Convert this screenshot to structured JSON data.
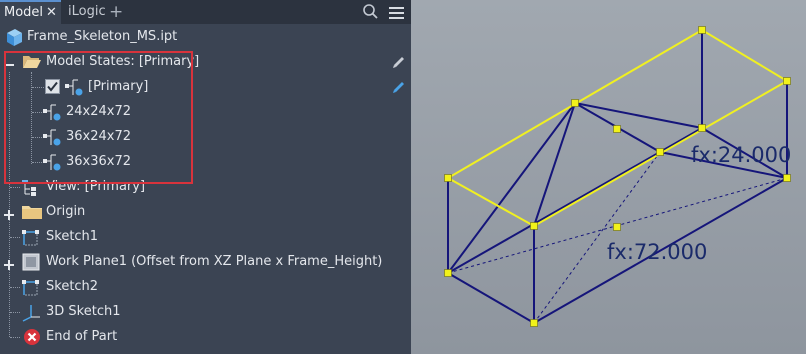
{
  "tabs": {
    "model_label": "Model",
    "model_close_glyph": "✕",
    "ilogic_label": "iLogic",
    "add_glyph": "+"
  },
  "tree": {
    "file_name": "Frame_Skeleton_MS.ipt",
    "model_states_label": "Model States: [Primary]",
    "states": [
      "[Primary]",
      "24x24x72",
      "36x24x72",
      "36x36x72"
    ],
    "view_label": "View: [Primary]",
    "origin_label": "Origin",
    "sketch1_label": "Sketch1",
    "workplane_label": "Work Plane1 (Offset from XZ Plane x Frame_Height)",
    "sketch2_label": "Sketch2",
    "sketch3d_label": "3D Sketch1",
    "end_label": "End of Part"
  },
  "viewport": {
    "dim_top": "fx:24.000",
    "dim_bottom": "fx:72.000"
  },
  "colors": {
    "panel_bg": "#3b4453",
    "highlight_border": "#d8333c",
    "edge_selected": "#f0f020",
    "edge_normal": "#15157a",
    "vertex": "#f2f21a",
    "dimension_text": "#1a2a6a"
  }
}
